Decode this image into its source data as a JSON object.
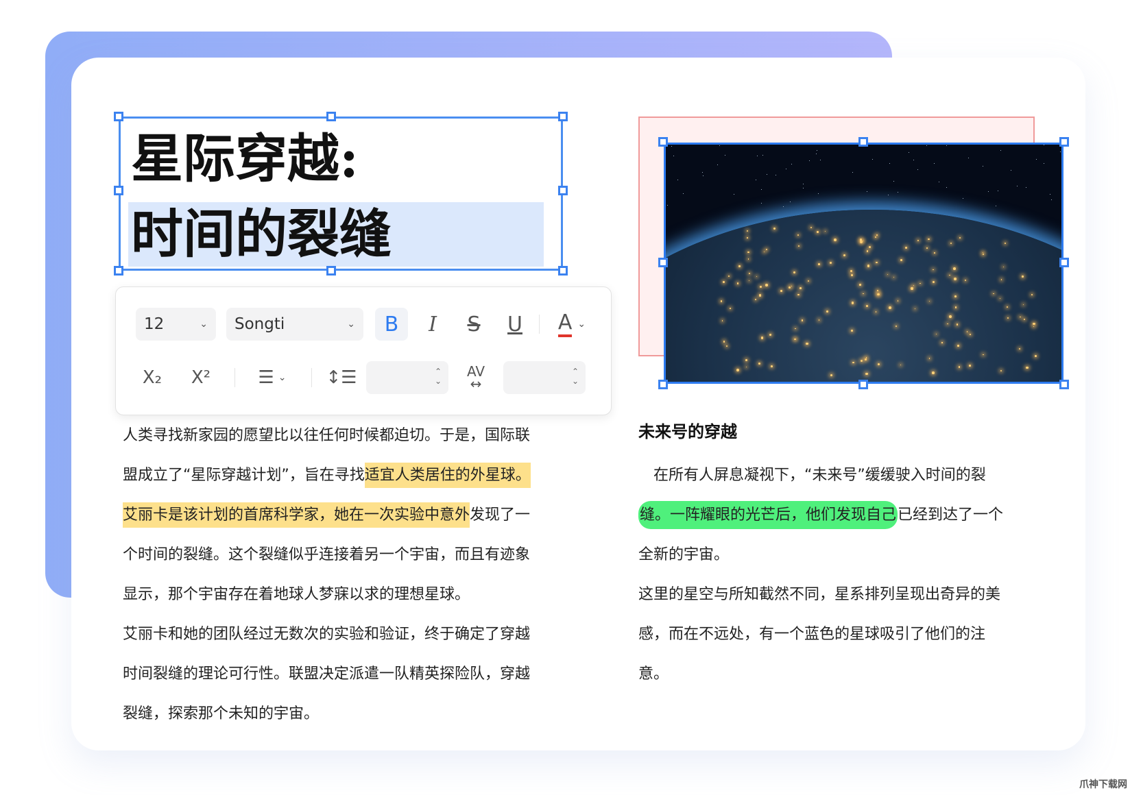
{
  "title": {
    "line1": "星际穿越:",
    "line2": "时间的裂缝"
  },
  "toolbar": {
    "font_size": "12",
    "font_family": "Songti",
    "bold": "B",
    "italic": "I",
    "strike": "S",
    "underline": "U",
    "color": "A",
    "subscript": "X₂",
    "superscript": "X²",
    "char_spacing": "AV",
    "text_color_hex": "#e0352b",
    "accent": "#2d7bf0"
  },
  "left_text": [
    [
      {
        "t": "人类寻找新家园的愿望比以往任何时候都迫切。于是，国际联"
      }
    ],
    [
      {
        "t": "盟成立了“星际穿越计划”，旨在寻找"
      },
      {
        "t": "适宜人类居住的外星球。",
        "h": "y"
      }
    ],
    [
      {
        "t": "艾丽卡是该计划的首席科学家，她在一次实验中意外",
        "h": "y"
      },
      {
        "t": "发现了一"
      }
    ],
    [
      {
        "t": "个时间的裂缝。这个裂缝似乎连接着另一个宇宙，而且有迹象"
      }
    ],
    [
      {
        "t": "显示，那个宇宙存在着地球人梦寐以求的理想星球。"
      }
    ],
    [
      {
        "t": "艾丽卡和她的团队经过无数次的实验和验证，终于确定了穿越"
      }
    ],
    [
      {
        "t": "时间裂缝的理论可行性。联盟决定派遣一队精英探险队，穿越"
      }
    ],
    [
      {
        "t": "裂缝，探索那个未知的宇宙。"
      }
    ]
  ],
  "right_heading": "未来号的穿越",
  "right_text": [
    [
      {
        "t": "　在所有人屏息凝视下，“未来号”缓缓驶入时间的裂"
      }
    ],
    [
      {
        "t": "缝。一阵耀眼的光芒后，他们发现自己",
        "h": "g"
      },
      {
        "t": "已经到达了一个"
      }
    ],
    [
      {
        "t": "全新的宇宙。"
      }
    ],
    [
      {
        "t": "这里的星空与所知截然不同，星系排列呈现出奇异的美"
      }
    ],
    [
      {
        "t": "感，而在不远处，有一个蓝色的星球吸引了他们的注"
      }
    ],
    [
      {
        "t": "意。"
      }
    ]
  ],
  "watermark": "爪神下载网"
}
